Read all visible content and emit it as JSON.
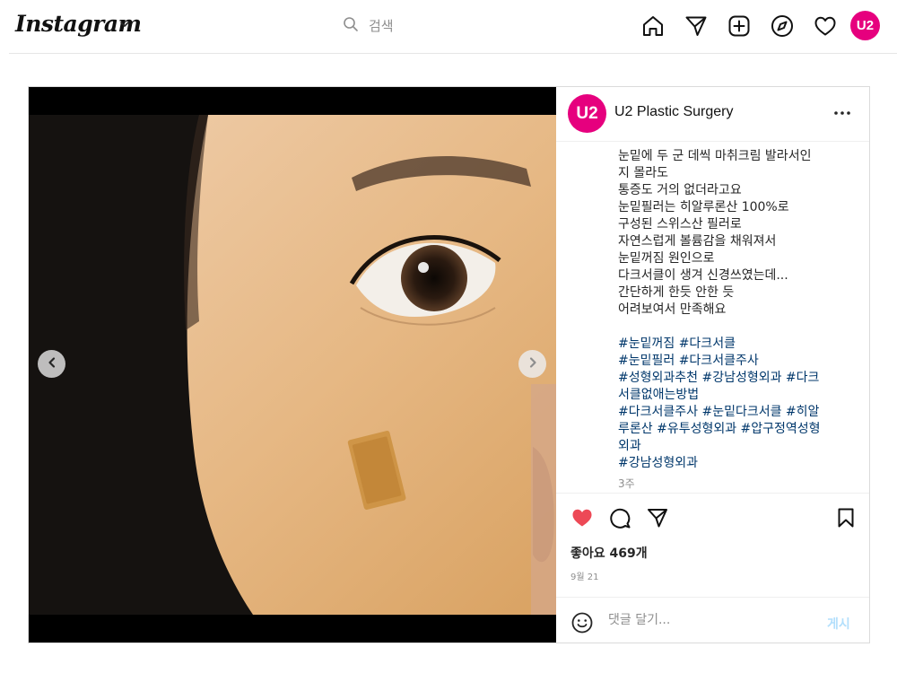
{
  "header": {
    "logo": "Instagram",
    "search_placeholder": "검색",
    "profile_initials": "U2"
  },
  "post": {
    "username": "U2 Plastic Surgery",
    "avatar_initials": "U2",
    "caption_lines": [
      "눈밑에 두 군 데씩 마취크림 발라서인",
      "지 몰라도",
      "통증도 거의 없더라고요",
      "눈밑필러는 히알루론산 100%로",
      "구성된 스위스산 필러로",
      "자연스럽게 볼륨감을 채워져서",
      "눈밑꺼짐 원인으로",
      "다크서클이 생겨 신경쓰였는데...",
      "간단하게 한듯 안한 듯",
      "어려보여서 만족해요"
    ],
    "hashtag_lines": [
      "#눈밑꺼짐 #다크서클",
      "#눈밑필러 #다크서클주사",
      "#성형외과추천 #강남성형외과 #다크",
      "서클없애는방법",
      "#다크서클주사 #눈밑다크서클 #히알",
      "루론산 #유투성형외과 #압구정역성형",
      "외과",
      "#강남성형외과"
    ],
    "time_ago": "3주",
    "likes": "좋아요 469개",
    "date": "9월 21",
    "comment_placeholder": "댓글 달기...",
    "post_button": "게시"
  },
  "colors": {
    "brand_avatar": "#e6007e",
    "like_red": "#ed4956",
    "hashtag": "#00376b",
    "post_button_disabled": "#b2dffc"
  },
  "icons": [
    "chevron-down-icon",
    "search-icon",
    "home-icon",
    "direct-icon",
    "new-post-icon",
    "explore-icon",
    "activity-heart-icon",
    "more-icon",
    "arrow-left-icon",
    "arrow-right-icon",
    "like-heart-icon",
    "comment-icon",
    "share-icon",
    "save-icon",
    "emoji-icon"
  ]
}
